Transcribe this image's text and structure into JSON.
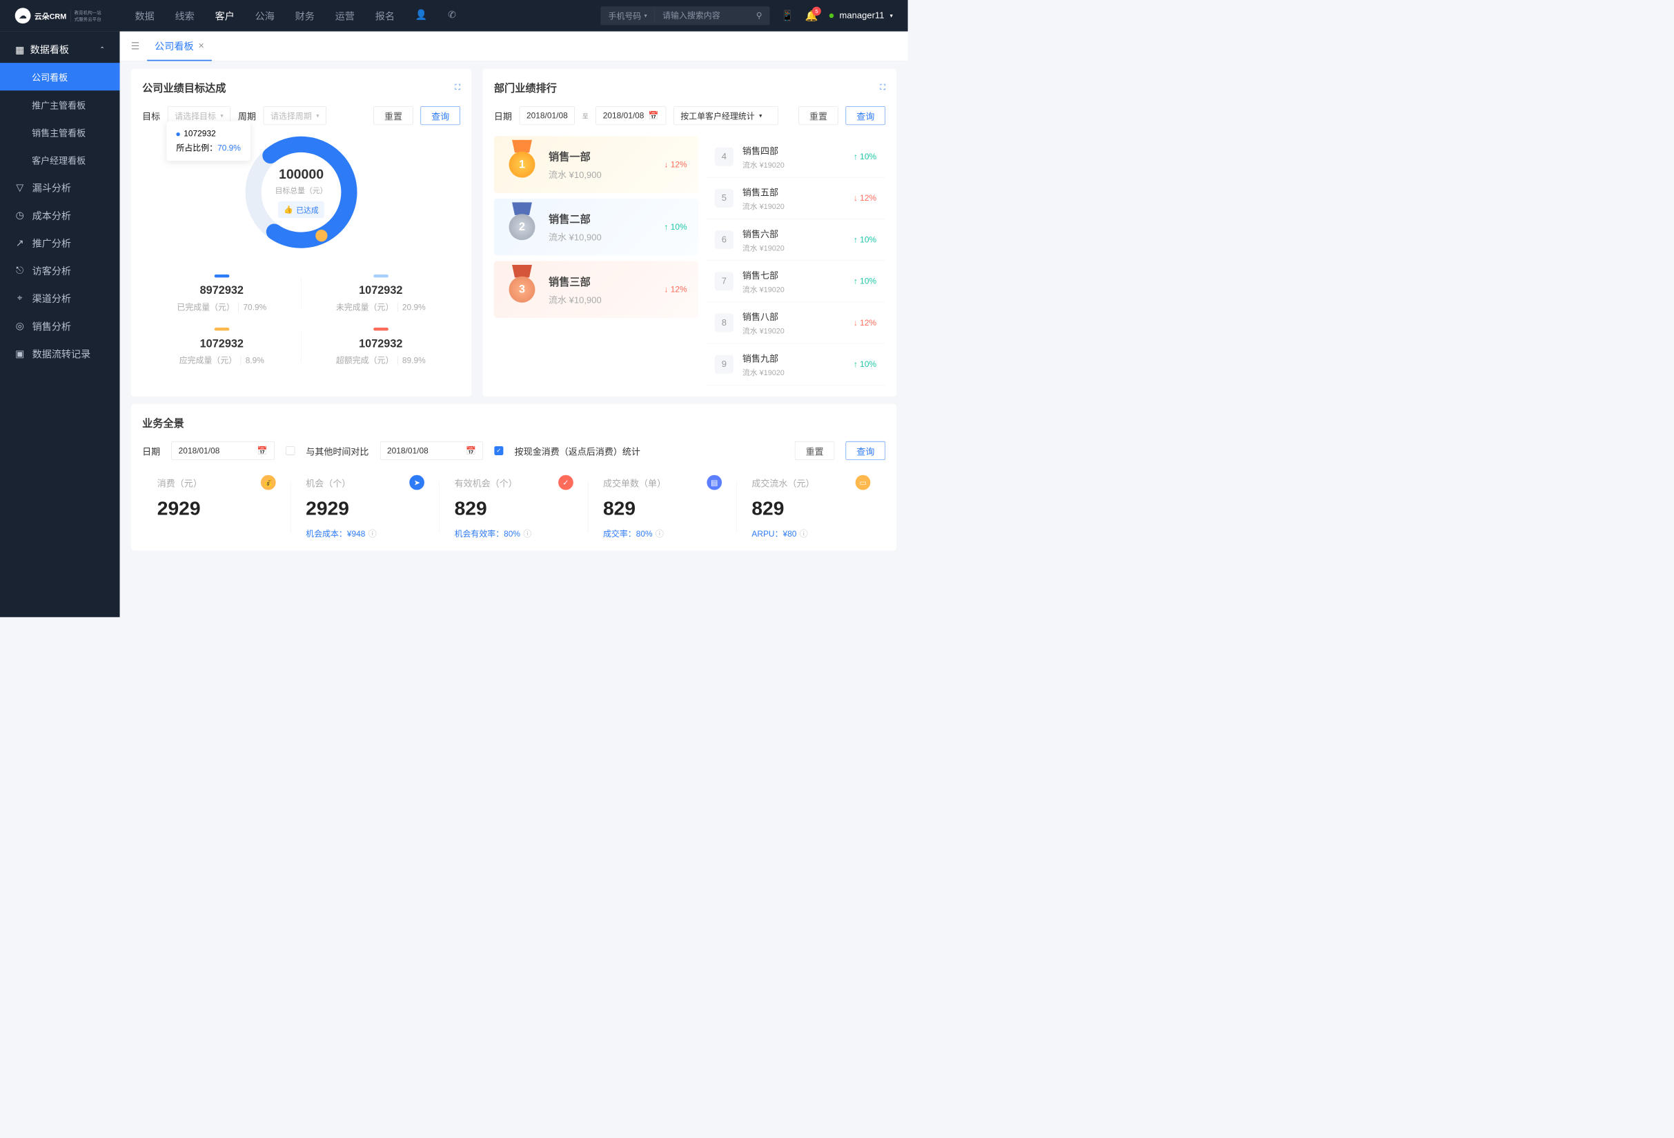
{
  "topnav": {
    "logo": "云朵CRM",
    "logo_sub1": "教育机构一站",
    "logo_sub2": "式服务云平台",
    "items": [
      "数据",
      "线索",
      "客户",
      "公海",
      "财务",
      "运营",
      "报名"
    ],
    "active_index": 2,
    "search_type": "手机号码",
    "search_placeholder": "请输入搜索内容",
    "badge": "5",
    "user": "manager11"
  },
  "sidebar": {
    "header": "数据看板",
    "subs": [
      "公司看板",
      "推广主管看板",
      "销售主管看板",
      "客户经理看板"
    ],
    "active_sub": 0,
    "items": [
      "漏斗分析",
      "成本分析",
      "推广分析",
      "访客分析",
      "渠道分析",
      "销售分析",
      "数据流转记录"
    ]
  },
  "tab": {
    "label": "公司看板"
  },
  "goal": {
    "title": "公司业绩目标达成",
    "filter_target": "目标",
    "target_placeholder": "请选择目标",
    "filter_period": "周期",
    "period_placeholder": "请选择周期",
    "reset": "重置",
    "query": "查询",
    "center_value": "100000",
    "center_label": "目标总量（元）",
    "badge": "已达成",
    "tooltip_value": "1072932",
    "tooltip_label": "所占比例：",
    "tooltip_pct": "70.9%",
    "stats": [
      {
        "value": "8972932",
        "label": "已完成量（元）",
        "pct": "70.9%"
      },
      {
        "value": "1072932",
        "label": "未完成量（元）",
        "pct": "20.9%"
      },
      {
        "value": "1072932",
        "label": "应完成量（元）",
        "pct": "8.9%"
      },
      {
        "value": "1072932",
        "label": "超额完成（元）",
        "pct": "89.9%"
      }
    ]
  },
  "ranking": {
    "title": "部门业绩排行",
    "filter_date": "日期",
    "date1": "2018/01/08",
    "date_to": "至",
    "date2": "2018/01/08",
    "filter_type": "按工单客户经理统计",
    "reset": "重置",
    "query": "查询",
    "top": [
      {
        "rank": "1",
        "name": "销售一部",
        "amount": "流水 ¥10,900",
        "pct": "12%",
        "dir": "down"
      },
      {
        "rank": "2",
        "name": "销售二部",
        "amount": "流水 ¥10,900",
        "pct": "10%",
        "dir": "up"
      },
      {
        "rank": "3",
        "name": "销售三部",
        "amount": "流水 ¥10,900",
        "pct": "12%",
        "dir": "down"
      }
    ],
    "rest": [
      {
        "rank": "4",
        "name": "销售四部",
        "amount": "流水 ¥19020",
        "pct": "10%",
        "dir": "up"
      },
      {
        "rank": "5",
        "name": "销售五部",
        "amount": "流水 ¥19020",
        "pct": "12%",
        "dir": "down"
      },
      {
        "rank": "6",
        "name": "销售六部",
        "amount": "流水 ¥19020",
        "pct": "10%",
        "dir": "up"
      },
      {
        "rank": "7",
        "name": "销售七部",
        "amount": "流水 ¥19020",
        "pct": "10%",
        "dir": "up"
      },
      {
        "rank": "8",
        "name": "销售八部",
        "amount": "流水 ¥19020",
        "pct": "12%",
        "dir": "down"
      },
      {
        "rank": "9",
        "name": "销售九部",
        "amount": "流水 ¥19020",
        "pct": "10%",
        "dir": "up"
      }
    ]
  },
  "overview": {
    "title": "业务全景",
    "filter_date": "日期",
    "date1": "2018/01/08",
    "compare_label": "与其他时间对比",
    "date2": "2018/01/08",
    "cash_label": "按现金消费（返点后消费）统计",
    "reset": "重置",
    "query": "查询",
    "metrics": [
      {
        "label": "消费（元）",
        "value": "2929",
        "sub": "",
        "color": "#ffb84d",
        "icon": "💰"
      },
      {
        "label": "机会（个）",
        "value": "2929",
        "sub": "机会成本：¥948",
        "color": "#2d7bf7",
        "icon": "➤"
      },
      {
        "label": "有效机会（个）",
        "value": "829",
        "sub": "机会有效率：80%",
        "color": "#ff6b5b",
        "icon": "✓"
      },
      {
        "label": "成交单数（单）",
        "value": "829",
        "sub": "成交率：80%",
        "color": "#5b7fff",
        "icon": "▤"
      },
      {
        "label": "成交流水（元）",
        "value": "829",
        "sub": "ARPU：¥80",
        "color": "#ffb84d",
        "icon": "▭"
      }
    ]
  },
  "chart_data": {
    "type": "pie",
    "title": "目标总量（元） 100000",
    "series": [
      {
        "name": "已完成",
        "value": 70.9
      },
      {
        "name": "未完成",
        "value": 29.1
      }
    ],
    "colors": [
      "#2d7bf7",
      "#e8eef7"
    ]
  }
}
